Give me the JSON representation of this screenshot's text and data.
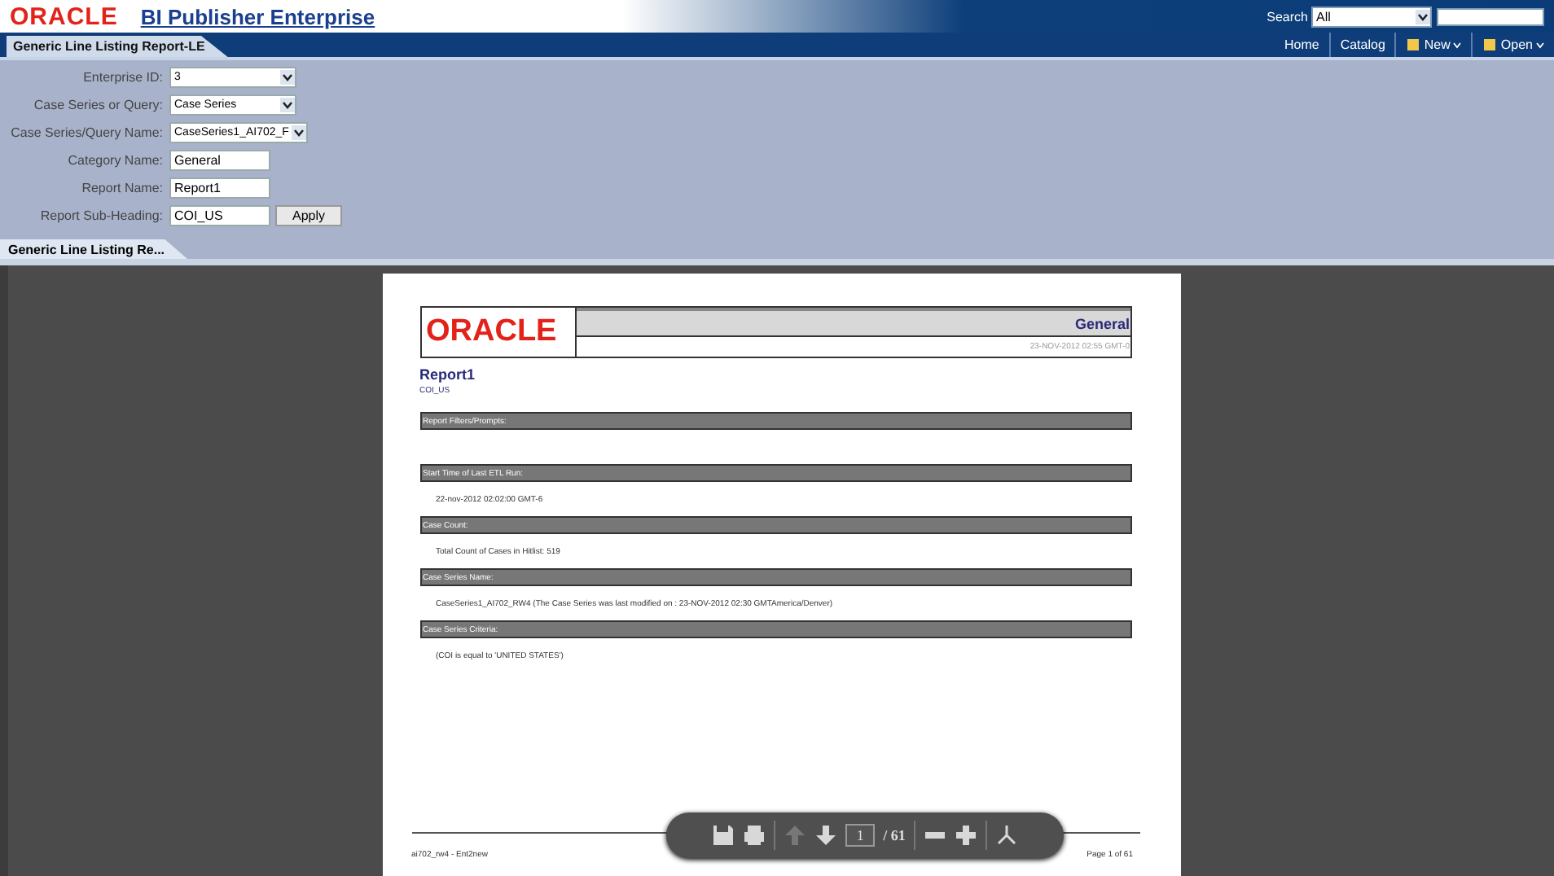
{
  "header": {
    "logo": "ORACLE",
    "product": "BI Publisher Enterprise",
    "search_label": "Search",
    "search_scope": "All"
  },
  "nav": {
    "report_tab": "Generic Line Listing Report-LE",
    "links": [
      {
        "label": "Home",
        "kind": "link"
      },
      {
        "label": "Catalog",
        "kind": "link"
      },
      {
        "label": "New",
        "kind": "menu"
      },
      {
        "label": "Open",
        "kind": "menu"
      }
    ]
  },
  "parameters": [
    {
      "label": "Enterprise ID:",
      "kind": "select",
      "value": "3"
    },
    {
      "label": "Case Series or Query:",
      "kind": "select",
      "value": "Case Series"
    },
    {
      "label": "Case Series/Query Name:",
      "kind": "select",
      "value": "CaseSeries1_AI702_F"
    },
    {
      "label": "Category Name:",
      "kind": "text",
      "value": "General"
    },
    {
      "label": "Report Name:",
      "kind": "text",
      "value": "Report1"
    },
    {
      "label": "Report Sub-Heading:",
      "kind": "text",
      "value": "COI_US"
    }
  ],
  "apply_button": "Apply",
  "viewer_tabs": [
    {
      "label": "Generic Line Listing Re...",
      "selected": true
    }
  ],
  "document": {
    "logo": "ORACLE",
    "band_title": "General",
    "timestamp": "23-NOV-2012 02:55 GMT-0",
    "title": "Report1",
    "subheading": "COI_US",
    "sections": [
      {
        "heading": "Report Filters/Prompts:"
      },
      {
        "heading": "Start Time of Last ETL Run:",
        "body": "22-nov-2012 02:02:00 GMT-6"
      },
      {
        "heading": "Case Count:",
        "body": "Total Count of Cases in Hitlist: 519"
      },
      {
        "heading": "Case Series Name:",
        "body": "CaseSeries1_AI702_RW4 (The Case Series was last modified on : 23-NOV-2012 02:30 GMTAmerica/Denver)"
      },
      {
        "heading": "Case Series Criteria:",
        "body": "(COI is equal to 'UNITED STATES')"
      }
    ],
    "footer_left": "ai702_rw4 - Ent2new",
    "footer_right": "Page 1 of 61"
  },
  "pdf_toolbar": {
    "page": "1",
    "total": "/ 61"
  }
}
